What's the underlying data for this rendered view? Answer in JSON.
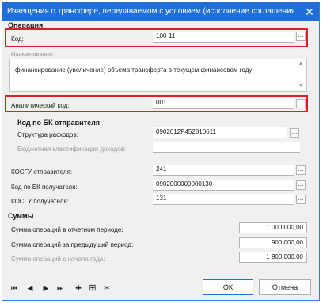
{
  "window": {
    "title": "Извещения о трансфере, передаваемом с условием (исполнение соглашения по тран..."
  },
  "operation": {
    "section_title": "Операция",
    "code_label": "Код:",
    "code_value": "100-11",
    "name_label": "Наименование:",
    "name_value": "финансирование (увеличение) объема трансферта в текущем финансовом году",
    "analytic_label": "Аналитический код:",
    "analytic_value": "001"
  },
  "bk_sender": {
    "section_title": "Код по БК отправителя",
    "expense_label": "Структура расходов:",
    "expense_value": "0902012P452810611",
    "income_label": "Бюджетная классификация доходов:",
    "income_value": ""
  },
  "kosgu_sender": {
    "label": "КОСГУ отправителя:",
    "value": "241"
  },
  "bk_receiver": {
    "label": "Код по БК получателя:",
    "value": "0902000000000130"
  },
  "kosgu_receiver": {
    "label": "КОСГУ получателя:",
    "value": "131"
  },
  "sums": {
    "section_title": "Суммы",
    "reporting_label": "Сумма операций в отчетном периоде:",
    "reporting_value": "1 000 000,00",
    "previous_label": "Сумма операций за предыдущий период:",
    "previous_value": "900 000,00",
    "ytd_label": "Сумма операций с начала года:",
    "ytd_value": "1 900 000,00"
  },
  "buttons": {
    "ok": "ОК",
    "cancel": "Отмена",
    "ellipsis": "..."
  },
  "icons": {
    "close": "✕",
    "first": "⏮",
    "prev": "◀",
    "next": "▶",
    "last": "⏭",
    "add": "✚",
    "add_copy": "⊞",
    "delete": "✂",
    "scroll_up": "▲",
    "scroll_down": "▼"
  },
  "colors": {
    "title_bar": "#1e6fd9",
    "highlight": "#e11c24"
  }
}
